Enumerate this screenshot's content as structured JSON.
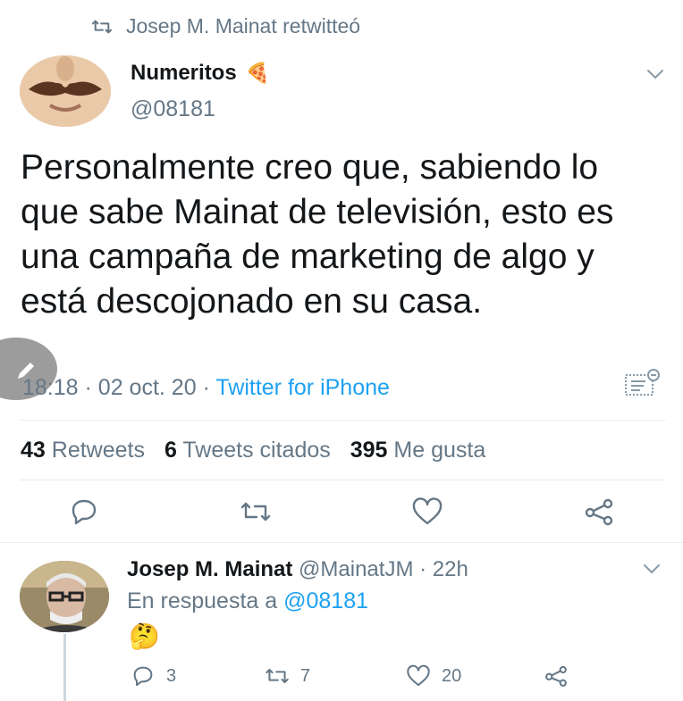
{
  "retweet_banner": {
    "text": "Josep M. Mainat retwitteó"
  },
  "tweet": {
    "author_name": "Numeritos",
    "author_emoji": "🍕",
    "author_handle": "@08181",
    "text": "Personalmente creo que, sabiendo lo que sabe Mainat de televisión, esto es una campaña de marketing de algo y está descojonado en su casa.",
    "time": "18:18",
    "date": "02 oct. 20",
    "separator": "·",
    "client": "Twitter for iPhone",
    "stats": {
      "retweets_count": "43",
      "retweets_label": "Retweets",
      "quotes_count": "6",
      "quotes_label": "Tweets citados",
      "likes_count": "395",
      "likes_label": "Me gusta"
    },
    "actions": [
      "reply-icon",
      "retweet-icon",
      "like-icon",
      "share-icon"
    ]
  },
  "reply": {
    "author_name": "Josep M. Mainat",
    "author_handle": "@MainatJM",
    "separator": "·",
    "time": "22h",
    "in_reply_prefix": "En respuesta a",
    "in_reply_handle": "@08181",
    "emoji": "🤔",
    "reply_count": "3",
    "retweet_count": "7",
    "like_count": "20"
  },
  "colors": {
    "accent": "#1da1f2",
    "text": "#14171a",
    "secondary": "#657786",
    "divider": "#e6ecf0"
  }
}
